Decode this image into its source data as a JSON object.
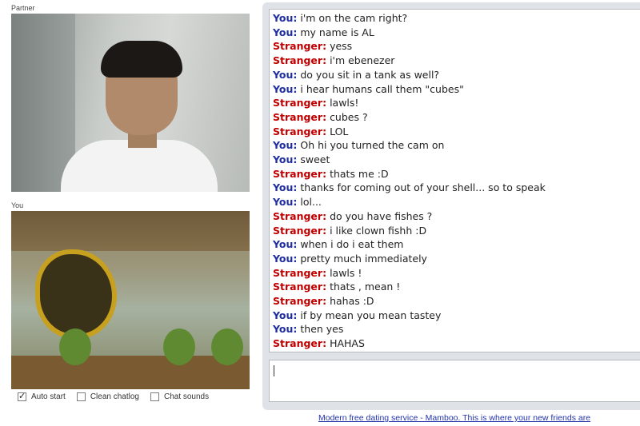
{
  "videos": {
    "partner_label": "Partner",
    "self_label": "You"
  },
  "options": [
    {
      "label": "Auto start",
      "checked": true
    },
    {
      "label": "Clean chatlog",
      "checked": false
    },
    {
      "label": "Chat sounds",
      "checked": false
    }
  ],
  "colors": {
    "you": "#1f2ea0",
    "stranger": "#c00000",
    "panel": "#dfe3e7",
    "link": "#2233aa"
  },
  "chat": [
    {
      "speaker": "You:",
      "role": "you",
      "text": "i'm on the cam right?"
    },
    {
      "speaker": "You:",
      "role": "you",
      "text": "my name is AL"
    },
    {
      "speaker": "Stranger:",
      "role": "stranger",
      "text": "yess"
    },
    {
      "speaker": "Stranger:",
      "role": "stranger",
      "text": "i'm ebenezer"
    },
    {
      "speaker": "You:",
      "role": "you",
      "text": "do you sit in a tank as well?"
    },
    {
      "speaker": "You:",
      "role": "you",
      "text": "i hear humans call them \"cubes\""
    },
    {
      "speaker": "Stranger:",
      "role": "stranger",
      "text": "lawls!"
    },
    {
      "speaker": "Stranger:",
      "role": "stranger",
      "text": "cubes ?"
    },
    {
      "speaker": "Stranger:",
      "role": "stranger",
      "text": "LOL"
    },
    {
      "speaker": "You:",
      "role": "you",
      "text": "Oh hi you turned the cam on"
    },
    {
      "speaker": "You:",
      "role": "you",
      "text": "sweet"
    },
    {
      "speaker": "Stranger:",
      "role": "stranger",
      "text": "thats me :D"
    },
    {
      "speaker": "You:",
      "role": "you",
      "text": "thanks for coming out of your shell... so to speak"
    },
    {
      "speaker": "You:",
      "role": "you",
      "text": "lol..."
    },
    {
      "speaker": "Stranger:",
      "role": "stranger",
      "text": "do you have fishes ?"
    },
    {
      "speaker": "Stranger:",
      "role": "stranger",
      "text": "i like clown fishh :D"
    },
    {
      "speaker": "You:",
      "role": "you",
      "text": "when i do i eat them"
    },
    {
      "speaker": "You:",
      "role": "you",
      "text": "pretty much immediately"
    },
    {
      "speaker": "Stranger:",
      "role": "stranger",
      "text": "lawls !"
    },
    {
      "speaker": "Stranger:",
      "role": "stranger",
      "text": "thats , mean !"
    },
    {
      "speaker": "Stranger:",
      "role": "stranger",
      "text": "hahas :D"
    },
    {
      "speaker": "You:",
      "role": "you",
      "text": "if by mean you mean tastey"
    },
    {
      "speaker": "You:",
      "role": "you",
      "text": "then yes"
    },
    {
      "speaker": "Stranger:",
      "role": "stranger",
      "text": "HAHAS"
    }
  ],
  "message_input": {
    "value": ""
  },
  "ad": {
    "text": "Modern free dating service - Mamboo. This is where your new friends are"
  }
}
